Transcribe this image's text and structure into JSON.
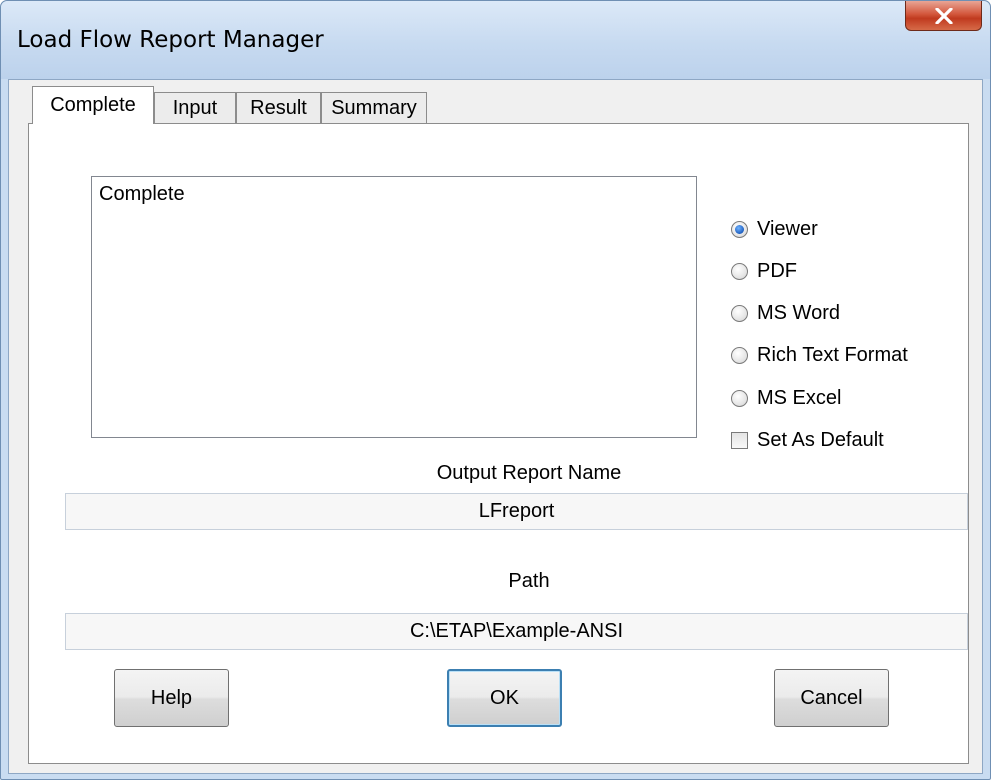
{
  "window": {
    "title": "Load Flow Report Manager",
    "close_icon": "close-x-icon",
    "accent_color": "#c9dcf1",
    "close_color": "#c8442a"
  },
  "tabs": [
    {
      "label": "Complete",
      "active": true
    },
    {
      "label": "Input",
      "active": false
    },
    {
      "label": "Result",
      "active": false
    },
    {
      "label": "Summary",
      "active": false
    }
  ],
  "report_list": {
    "items": [
      "Complete"
    ]
  },
  "format_options": [
    {
      "label": "Viewer",
      "checked": true
    },
    {
      "label": "PDF",
      "checked": false
    },
    {
      "label": "MS Word",
      "checked": false
    },
    {
      "label": "Rich Text Format",
      "checked": false
    },
    {
      "label": "MS Excel",
      "checked": false
    }
  ],
  "set_default": {
    "label": "Set As Default",
    "checked": false
  },
  "output_report": {
    "label": "Output Report Name",
    "value": "LFreport"
  },
  "path": {
    "label": "Path",
    "value": "C:\\ETAP\\Example-ANSI"
  },
  "buttons": {
    "help": "Help",
    "ok": "OK",
    "cancel": "Cancel"
  }
}
